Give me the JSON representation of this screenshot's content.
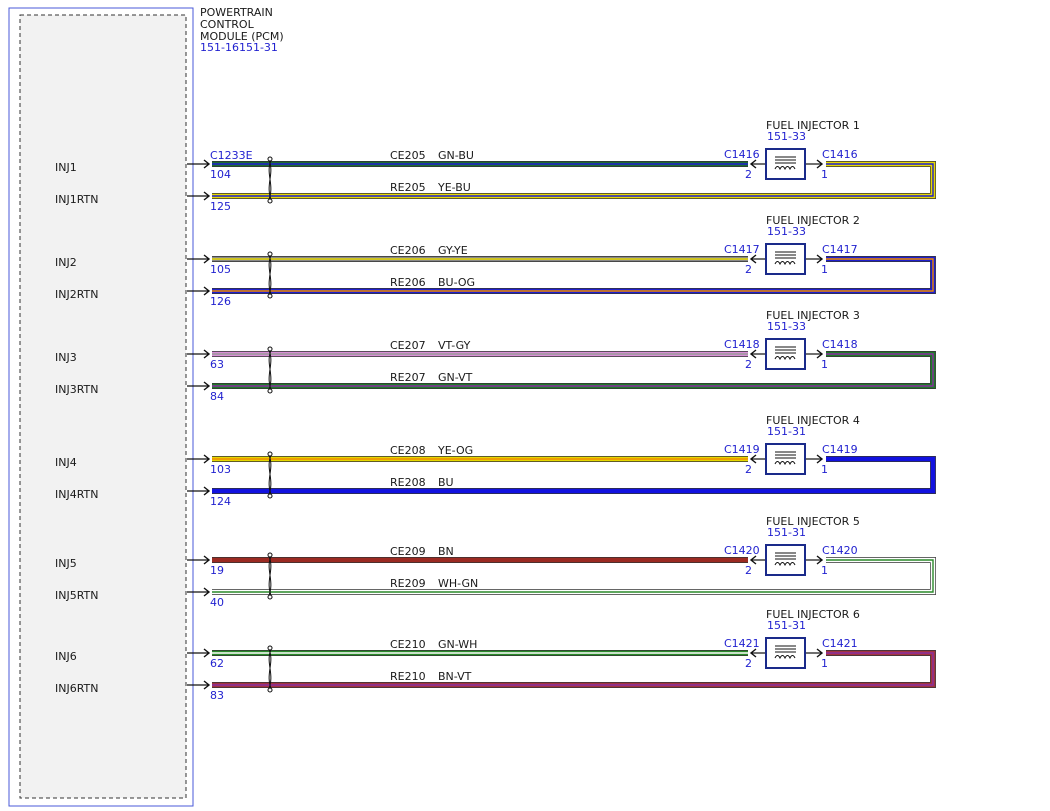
{
  "module": {
    "name_lines": [
      "POWERTRAIN",
      "CONTROL",
      "MODULE (PCM)"
    ],
    "ref": "151-16151-31",
    "connector": "C1233E"
  },
  "circuits": [
    {
      "injector": "FUEL INJECTOR 1",
      "ref": "151-33",
      "conn": "C1416",
      "pin_a": "2",
      "pin_b": "1",
      "sig": {
        "label": "INJ1",
        "pin": "104",
        "circuit": "CE205",
        "color_code": "GN-BU",
        "colors": [
          "#1b6b34",
          "#1f1fcf"
        ]
      },
      "rtn": {
        "label": "INJ1RTN",
        "pin": "125",
        "circuit": "RE205",
        "color_code": "YE-BU",
        "colors": [
          "#e6d800",
          "#1f1fcf"
        ]
      }
    },
    {
      "injector": "FUEL INJECTOR 2",
      "ref": "151-33",
      "conn": "C1417",
      "pin_a": "2",
      "pin_b": "1",
      "sig": {
        "label": "INJ2",
        "pin": "105",
        "circuit": "CE206",
        "color_code": "GY-YE",
        "colors": [
          "#8a8a8a",
          "#e6d800"
        ]
      },
      "rtn": {
        "label": "INJ2RTN",
        "pin": "126",
        "circuit": "RE206",
        "color_code": "BU-OG",
        "colors": [
          "#1f1fcf",
          "#f08a00"
        ]
      }
    },
    {
      "injector": "FUEL INJECTOR 3",
      "ref": "151-33",
      "conn": "C1418",
      "pin_a": "2",
      "pin_b": "1",
      "sig": {
        "label": "INJ3",
        "pin": "63",
        "circuit": "CE207",
        "color_code": "VT-GY",
        "colors": [
          "#d98fd6",
          "#9a9a9a"
        ]
      },
      "rtn": {
        "label": "INJ3RTN",
        "pin": "84",
        "circuit": "RE207",
        "color_code": "GN-VT",
        "colors": [
          "#1f7a2a",
          "#8a2ea0"
        ]
      }
    },
    {
      "injector": "FUEL INJECTOR 4",
      "ref": "151-31",
      "conn": "C1419",
      "pin_a": "2",
      "pin_b": "1",
      "sig": {
        "label": "INJ4",
        "pin": "103",
        "circuit": "CE208",
        "color_code": "YE-OG",
        "colors": [
          "#e6d800",
          "#f08a00"
        ]
      },
      "rtn": {
        "label": "INJ4RTN",
        "pin": "124",
        "circuit": "RE208",
        "color_code": "BU",
        "colors": [
          "#1212e0"
        ]
      }
    },
    {
      "injector": "FUEL INJECTOR 5",
      "ref": "151-31",
      "conn": "C1420",
      "pin_a": "2",
      "pin_b": "1",
      "sig": {
        "label": "INJ5",
        "pin": "19",
        "circuit": "CE209",
        "color_code": "BN",
        "colors": [
          "#9b2a22"
        ]
      },
      "rtn": {
        "label": "INJ5RTN",
        "pin": "40",
        "circuit": "RE209",
        "color_code": "WH-GN",
        "colors": [
          "#ffffff",
          "#2a8a2a"
        ]
      }
    },
    {
      "injector": "FUEL INJECTOR 6",
      "ref": "151-31",
      "conn": "C1421",
      "pin_a": "2",
      "pin_b": "1",
      "sig": {
        "label": "INJ6",
        "pin": "62",
        "circuit": "CE210",
        "color_code": "GN-WH",
        "colors": [
          "#2a8a2a",
          "#ffffff"
        ]
      },
      "rtn": {
        "label": "INJ6RTN",
        "pin": "83",
        "circuit": "RE210",
        "color_code": "BN-VT",
        "colors": [
          "#a3333f",
          "#8a2ea0"
        ]
      }
    }
  ]
}
